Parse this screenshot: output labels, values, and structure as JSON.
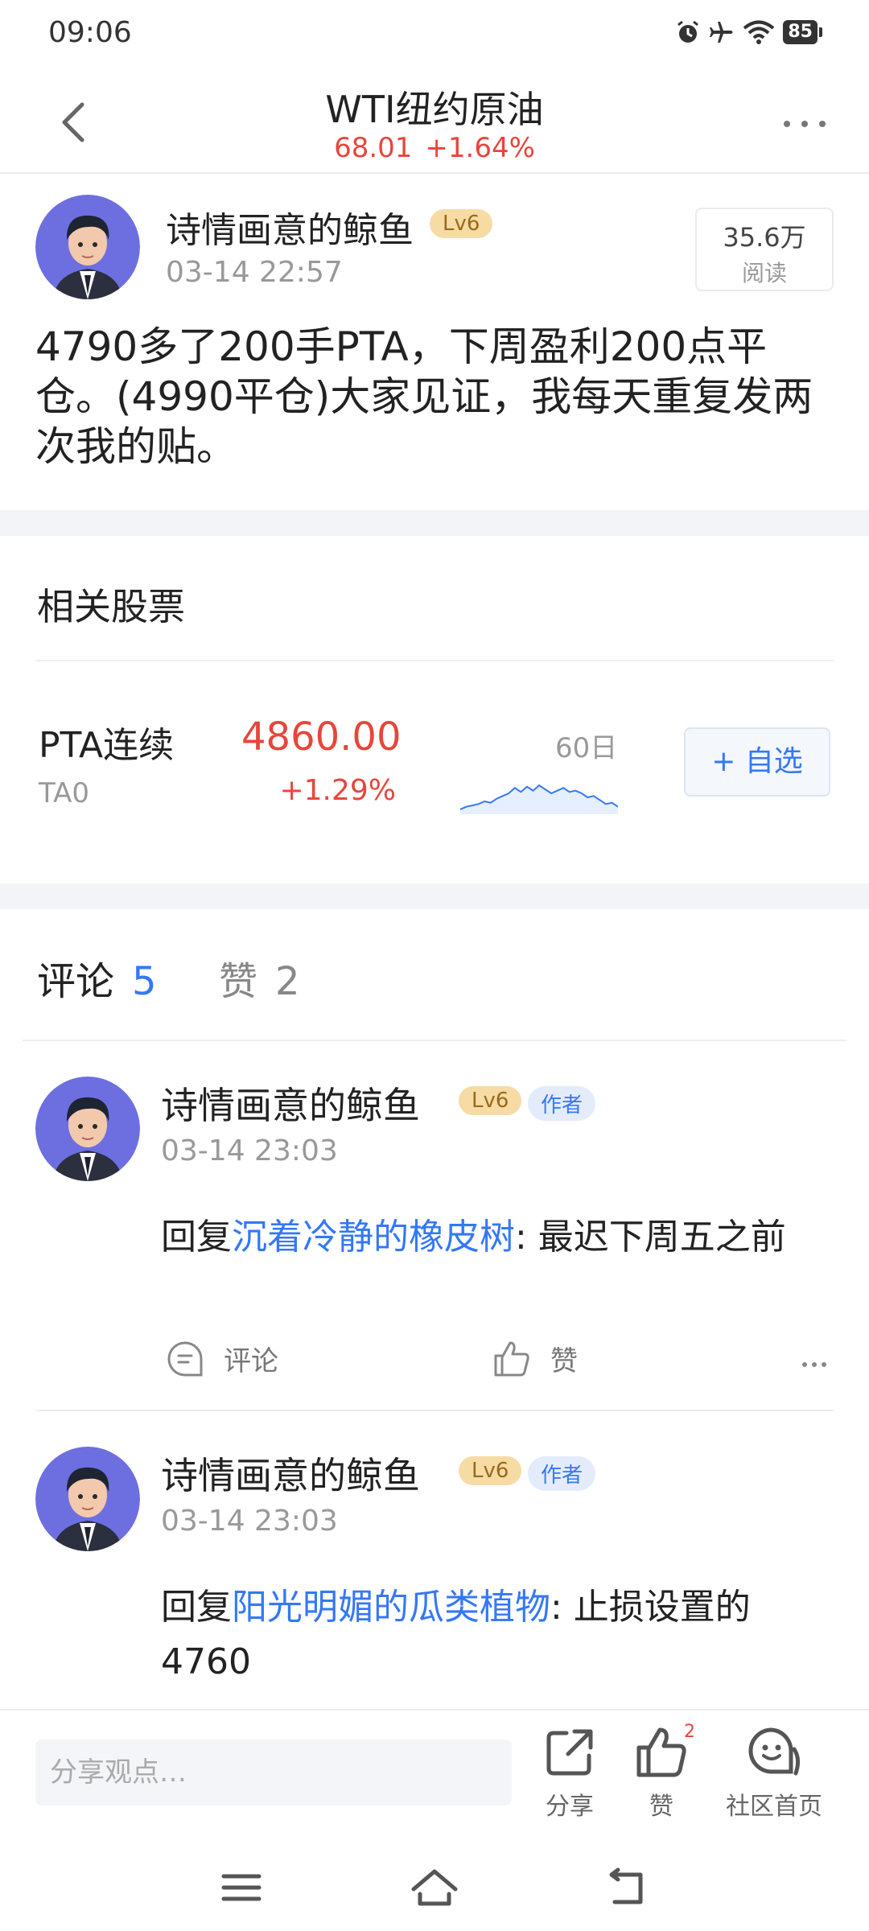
{
  "status_bar": {
    "time": "09:06",
    "battery": "85"
  },
  "header": {
    "title": "WTI纽约原油",
    "price": "68.01",
    "change": "+1.64%"
  },
  "post": {
    "author": "诗情画意的鲸鱼",
    "level": "Lv6",
    "time": "03-14 22:57",
    "read_count": "35.6万",
    "read_label": "阅读",
    "body": "4790多了200手PTA，下周盈利200点平仓。(4990平仓)大家见证，我每天重复发两次我的贴。"
  },
  "related": {
    "title": "相关股票",
    "stock": {
      "name": "PTA连续",
      "code": "TA0",
      "price": "4860.00",
      "change": "+1.29%",
      "chart_label": "60日",
      "watch_label": "+ 自选",
      "trend": [
        3,
        4,
        4.5,
        5,
        6,
        5.5,
        7,
        8,
        9,
        11,
        9.5,
        11.5,
        10,
        12,
        10.5,
        9,
        10,
        11,
        9.5,
        10,
        9,
        7.5,
        8,
        6.5,
        5,
        5.5,
        4
      ]
    }
  },
  "tabs": {
    "comments_label": "评论",
    "comments_count": "5",
    "likes_label": "赞",
    "likes_count": "2"
  },
  "comments": [
    {
      "author": "诗情画意的鲸鱼",
      "level": "Lv6",
      "tag": "作者",
      "time": "03-14 23:03",
      "prefix": "回复",
      "mention": "沉着冷静的橡皮树",
      "text": ": 最迟下周五之前",
      "comment_label": "评论",
      "like_label": "赞"
    },
    {
      "author": "诗情画意的鲸鱼",
      "level": "Lv6",
      "tag": "作者",
      "time": "03-14 23:03",
      "prefix": "回复",
      "mention": "阳光明媚的瓜类植物",
      "text": ": 止损设置的4760"
    }
  ],
  "bottom_bar": {
    "input_placeholder": "分享观点…",
    "share_label": "分享",
    "like_label": "赞",
    "like_count": "2",
    "community_label": "社区首页"
  },
  "colors": {
    "up_red": "#e8453c",
    "accent_blue": "#3478f6"
  }
}
